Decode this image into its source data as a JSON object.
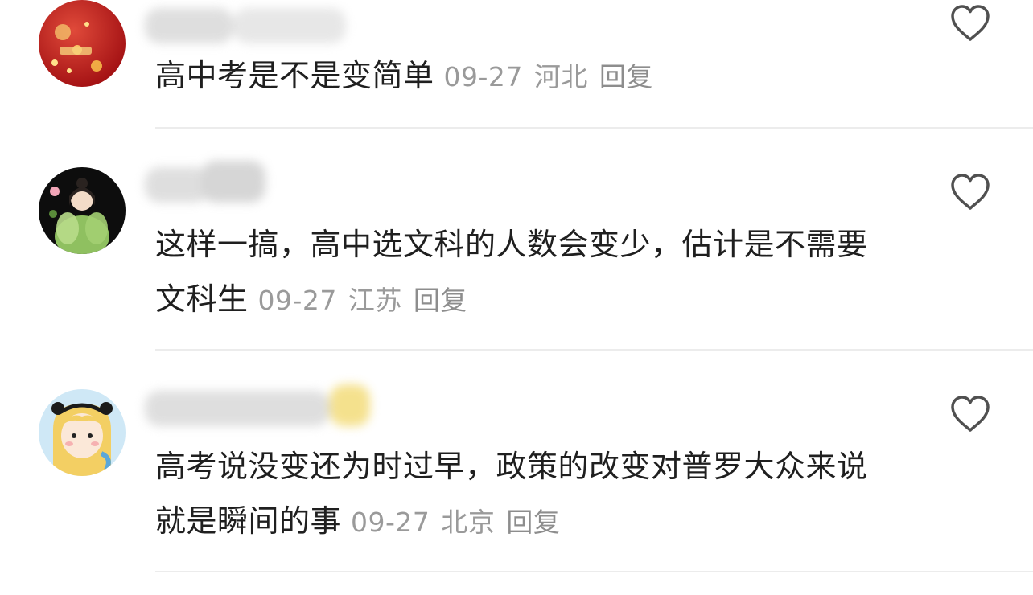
{
  "comments": [
    {
      "avatar": "red-festive-avatar",
      "text": "高中考是不是变简单",
      "date": "09-27",
      "location": "河北",
      "reply_label": "回复",
      "like_icon": "heart-outline-icon"
    },
    {
      "avatar": "girl-in-green-dress-avatar",
      "text": "这样一搞，高中选文科的人数会变少，估计是不需要文科生",
      "date": "09-27",
      "location": "江苏",
      "reply_label": "回复",
      "like_icon": "heart-outline-icon"
    },
    {
      "avatar": "cartoon-blonde-girl-avatar",
      "text": "高考说没变还为时过早，政策的改变对普罗大众来说就是瞬间的事",
      "date": "09-27",
      "location": "北京",
      "reply_label": "回复",
      "like_icon": "heart-outline-icon"
    }
  ],
  "colors": {
    "text": "#1f1f1f",
    "meta": "#9a9a9a",
    "divider": "#ececec",
    "icon": "#505050"
  }
}
